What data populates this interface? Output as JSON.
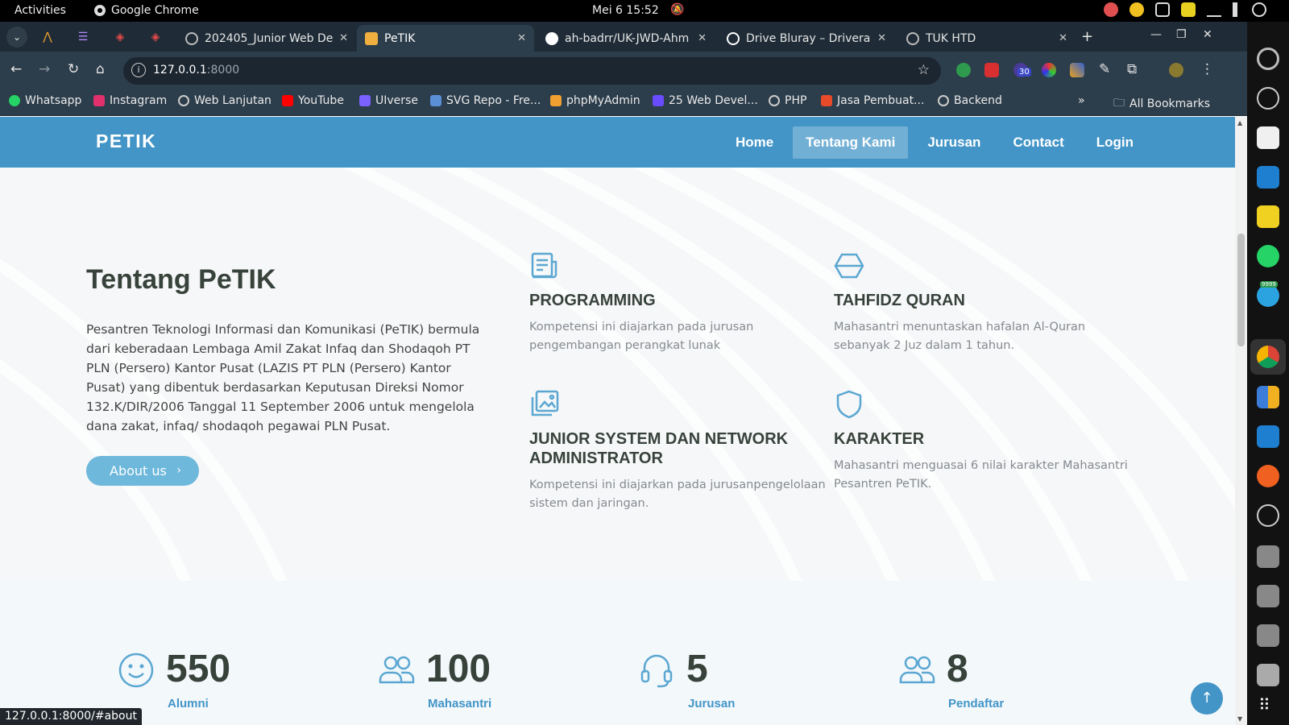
{
  "system": {
    "activities": "Activities",
    "app_name": "Google Chrome",
    "clock": "Mei 6  15:52"
  },
  "browser": {
    "tabs": [
      {
        "title": "202405_Junior Web De",
        "active": false
      },
      {
        "title": "PeTIK",
        "active": true
      },
      {
        "title": "ah-badrr/UK-JWD-Ahm",
        "active": false
      },
      {
        "title": "Drive Bluray – Driveray",
        "active": false
      },
      {
        "title": "TUK HTD",
        "active": false
      }
    ],
    "url_host": "127.0.0.1",
    "url_port": ":8000",
    "ext_badge": "30",
    "bookmarks": [
      {
        "label": "Whatsapp",
        "color": "#25d366"
      },
      {
        "label": "Instagram",
        "color": "#e1306c"
      },
      {
        "label": "Web Lanjutan",
        "color": "#9aa6af"
      },
      {
        "label": "YouTube",
        "color": "#ff0000"
      },
      {
        "label": "UIverse",
        "color": "#7b61ff"
      },
      {
        "label": "SVG Repo - Fre...",
        "color": "#5a8fd6"
      },
      {
        "label": "phpMyAdmin",
        "color": "#f0a030"
      },
      {
        "label": "25 Web Devel...",
        "color": "#6a4cff"
      },
      {
        "label": "PHP",
        "color": "#9aa6af"
      },
      {
        "label": "Jasa Pembuat...",
        "color": "#e84a2a"
      },
      {
        "label": "Backend",
        "color": "#9aa6af"
      }
    ],
    "all_bookmarks": "All Bookmarks",
    "status_url": "127.0.0.1:8000/#about",
    "dock_badge": "9999"
  },
  "site": {
    "logo": "PETIK",
    "menu": [
      {
        "label": "Home",
        "active": false
      },
      {
        "label": "Tentang Kami",
        "active": true
      },
      {
        "label": "Jurusan",
        "active": false
      },
      {
        "label": "Contact",
        "active": false
      },
      {
        "label": "Login",
        "active": false
      }
    ],
    "about": {
      "title": "Tentang PeTIK",
      "text": "Pesantren Teknologi Informasi dan Komunikasi (PeTIK) bermula dari keberadaan Lembaga Amil Zakat Infaq dan Shodaqoh PT PLN (Persero) Kantor Pusat (LAZIS PT PLN (Persero) Kantor Pusat) yang dibentuk berdasarkan Keputusan Direksi Nomor 132.K/DIR/2006 Tanggal 11 September 2006 untuk mengelola dana zakat, infaq/ shodaqoh pegawai PLN Pusat.",
      "button": "About us"
    },
    "features": [
      {
        "icon": "document-icon",
        "title": "PROGRAMMING",
        "text": "Kompetensi ini diajarkan pada jurusan pengembangan perangkat lunak"
      },
      {
        "icon": "cube-icon",
        "title": "TAHFIDZ QURAN",
        "text": "Mahasantri menuntaskan hafalan Al-Quran sebanyak 2 Juz dalam 1 tahun."
      },
      {
        "icon": "images-icon",
        "title": "JUNIOR SYSTEM DAN NETWORK ADMINISTRATOR",
        "text": "Kompetensi ini diajarkan pada jurusanpengelolaan sistem dan jaringan."
      },
      {
        "icon": "shield-icon",
        "title": "KARAKTER",
        "text": "Mahasantri menguasai 6 nilai karakter Mahasantri Pesantren PeTIK."
      }
    ],
    "counts": [
      {
        "icon": "smile-icon",
        "value": "550",
        "label": "Alumni"
      },
      {
        "icon": "people-icon",
        "value": "100",
        "label": "Mahasantri"
      },
      {
        "icon": "headset-icon",
        "value": "5",
        "label": "Jurusan"
      },
      {
        "icon": "people-icon",
        "value": "8",
        "label": "Pendaftar"
      }
    ]
  },
  "colors": {
    "header": "#4395c7",
    "accent_button": "#6eb8db",
    "heading": "#37423b"
  }
}
